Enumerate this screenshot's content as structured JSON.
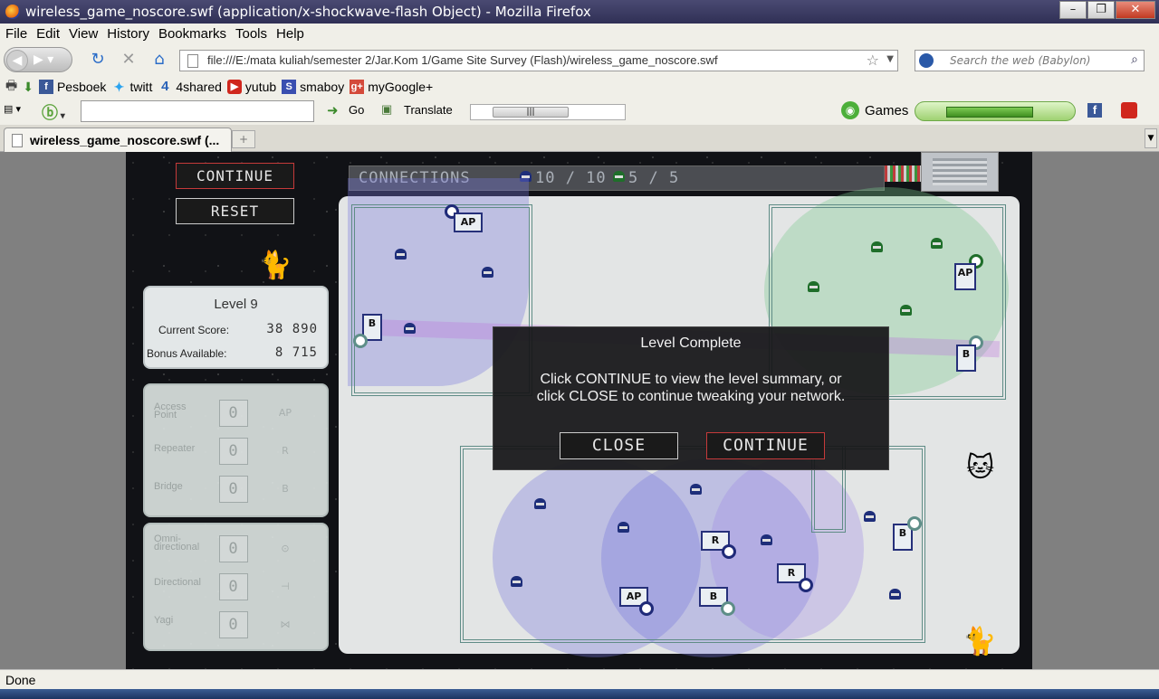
{
  "window": {
    "title": "wireless_game_noscore.swf (application/x-shockwave-flash Object) - Mozilla Firefox",
    "controls": [
      "–",
      "❐",
      "✕"
    ]
  },
  "menu": [
    "File",
    "Edit",
    "View",
    "History",
    "Bookmarks",
    "Tools",
    "Help"
  ],
  "nav": {
    "url": "file:///E:/mata kuliah/semester 2/Jar.Kom 1/Game Site Survey (Flash)/wireless_game_noscore.swf",
    "search_placeholder": "Search the web (Babylon)"
  },
  "bookmarks": [
    {
      "label": "Pesboek",
      "icon": "facebook-icon",
      "color": "#3b5998"
    },
    {
      "label": "twitt",
      "icon": "twitter-icon",
      "color": "#2aa3ef"
    },
    {
      "label": "4shared",
      "icon": "4shared-icon",
      "color": "#2a63b8"
    },
    {
      "label": "yutub",
      "icon": "youtube-icon",
      "color": "#d0271d"
    },
    {
      "label": "smaboy",
      "icon": "s-icon",
      "color": "#3a4fb0"
    },
    {
      "label": "myGoogle+",
      "icon": "google-plus-icon",
      "color": "#d44a3a"
    }
  ],
  "toolbar": {
    "go": "Go",
    "translate": "Translate",
    "games": "Games"
  },
  "tab": {
    "title": "wireless_game_noscore.swf (...",
    "new_tab": "+"
  },
  "game": {
    "continue_label": "CONTINUE",
    "reset_label": "RESET",
    "connections": {
      "label": "CONNECTIONS",
      "blue": "10 / 10",
      "green": "5 / 5"
    },
    "level": "Level 9",
    "current_score_label": "Current Score:",
    "current_score": "38 890",
    "bonus_label": "Bonus Available:",
    "bonus": "8 715",
    "inventory": [
      {
        "label": "Access Point",
        "count": "0",
        "device": "AP"
      },
      {
        "label": "Repeater",
        "count": "0",
        "device": "R"
      },
      {
        "label": "Bridge",
        "count": "0",
        "device": "B"
      }
    ],
    "antennas": [
      {
        "label": "Omni-directional",
        "count": "0"
      },
      {
        "label": "Directional",
        "count": "0"
      },
      {
        "label": "Yagi",
        "count": "0"
      }
    ],
    "devices": {
      "ap": "AP",
      "bridge": "B",
      "repeater": "R"
    },
    "dialog": {
      "title": "Level Complete",
      "line1": "Click CONTINUE to view the level summary, or",
      "line2": "click CLOSE to continue tweaking your network.",
      "close": "CLOSE",
      "continue": "CONTINUE"
    }
  },
  "status": "Done"
}
